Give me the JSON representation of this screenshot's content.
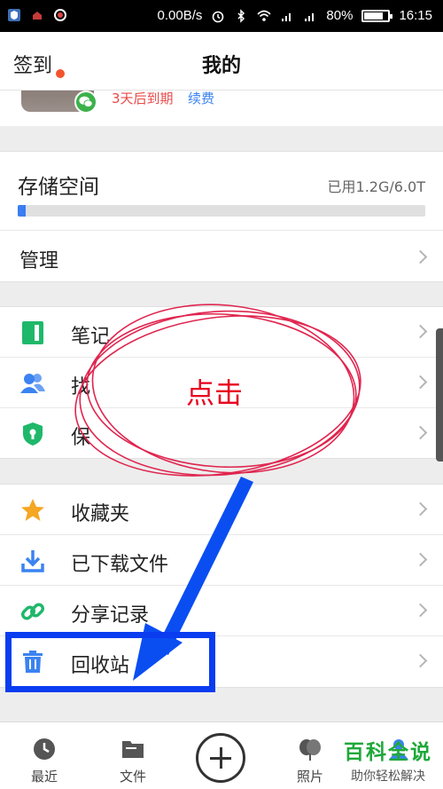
{
  "status_bar": {
    "net_speed": "0.00B/s",
    "battery": "80%",
    "battery_level": 0.8,
    "time": "16:15"
  },
  "nav": {
    "left_label": "签到",
    "title": "我的"
  },
  "profile": {
    "expire_text": "3天后到期",
    "renew_text": "续费"
  },
  "storage": {
    "title": "存储空间",
    "used_text": "已用1.2G/6.0T",
    "used_fraction": 0.02,
    "manage_label": "管理"
  },
  "group1": [
    {
      "label": "笔记",
      "icon": "note-icon",
      "color": "#1fb86a"
    },
    {
      "label": "找",
      "icon": "contacts-icon",
      "color": "#3b83f0"
    },
    {
      "label": "保",
      "icon": "shield-icon",
      "color": "#1fb86a"
    }
  ],
  "group2": [
    {
      "label": "收藏夹",
      "icon": "star-icon",
      "color": "#f5a623"
    },
    {
      "label": "已下载文件",
      "icon": "download-icon",
      "color": "#3b83f0"
    },
    {
      "label": "分享记录",
      "icon": "link-icon",
      "color": "#1fb86a"
    },
    {
      "label": "回收站",
      "icon": "trash-icon",
      "color": "#3b83f0"
    }
  ],
  "tabbar": {
    "recent": "最近",
    "files": "文件",
    "photos": "照片"
  },
  "annotation": {
    "text": "点击"
  },
  "watermark": {
    "title": "百科全说",
    "subtitle": "助你轻松解决"
  }
}
